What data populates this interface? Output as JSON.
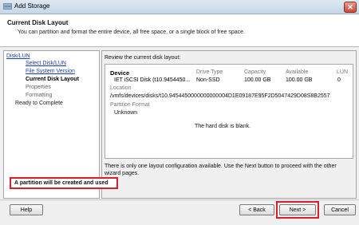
{
  "window": {
    "title": "Add Storage"
  },
  "header": {
    "title": "Current Disk Layout",
    "description": "You can partition and format the entire device, all free space, or a single block of free space."
  },
  "sidebar": {
    "items": [
      {
        "label": "Disk/LUN"
      },
      {
        "label": "Select Disk/LUN"
      },
      {
        "label": "File System Version"
      },
      {
        "label": "Current Disk Layout"
      },
      {
        "label": "Properties"
      },
      {
        "label": "Formatting"
      },
      {
        "label": "Ready to Complete"
      }
    ]
  },
  "main": {
    "review_label": "Review the current disk layout:",
    "columns": [
      "Device",
      "Drive Type",
      "Capacity",
      "Available",
      "LUN"
    ],
    "row": {
      "device": "IET iSCSI Disk (t10.9454450...",
      "drive_type": "Non-SSD",
      "capacity": "100.00 GB",
      "available": "100.00 GB",
      "lun": "0"
    },
    "location_label": "Location",
    "location_path": "/vmfs/devices/disks/t10.9454450000000000004D1E09187E95F2D5047429D08S8B2557",
    "partition_format_label": "Partition Format",
    "partition_format_value": "Unknown",
    "blank_message": "The hard disk is blank.",
    "info_text": "There is only one layout configuration available. Use the Next button to proceed with the other wizard pages.",
    "partition_note": "A partition will be created and used"
  },
  "footer": {
    "help_label": "Help",
    "back_label": "< Back",
    "next_label": "Next >",
    "cancel_label": "Cancel"
  },
  "colors": {
    "highlight": "#d8202a",
    "link": "#1b3fa8"
  }
}
